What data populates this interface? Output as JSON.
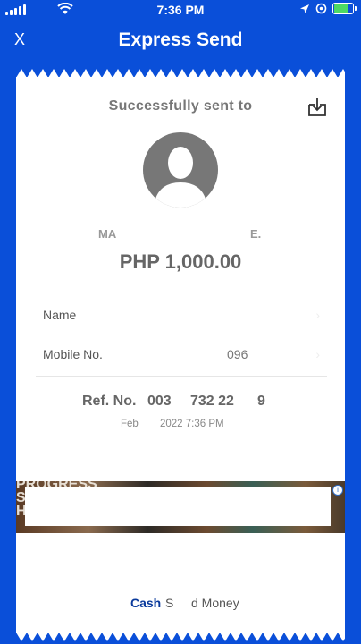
{
  "status_bar": {
    "time": "7:36 PM"
  },
  "header": {
    "close_label": "X",
    "title": "Express Send"
  },
  "receipt": {
    "sent_label": "Successfully sent to",
    "recipient_name_start": "MA",
    "recipient_name_end": "E.",
    "amount": "PHP 1,000.00",
    "name_label": "Name",
    "mobile_label": "Mobile No.",
    "mobile_value": "096",
    "ref_label": "Ref. No.",
    "ref_parts": [
      "003",
      "732 22",
      "9"
    ],
    "date_month": "Feb",
    "date_rest": "2022 7:36 PM"
  },
  "ad": {
    "text": "PROGRESS\nS\nHEALTH",
    "info_glyph": "i"
  },
  "footer": {
    "brand_cash": "Cash",
    "brand_s": "S",
    "brand_rest": "d Money"
  },
  "colors": {
    "primary": "#0a4fd9",
    "brand_dark": "#0a3a9c",
    "battery": "#4cd964"
  }
}
